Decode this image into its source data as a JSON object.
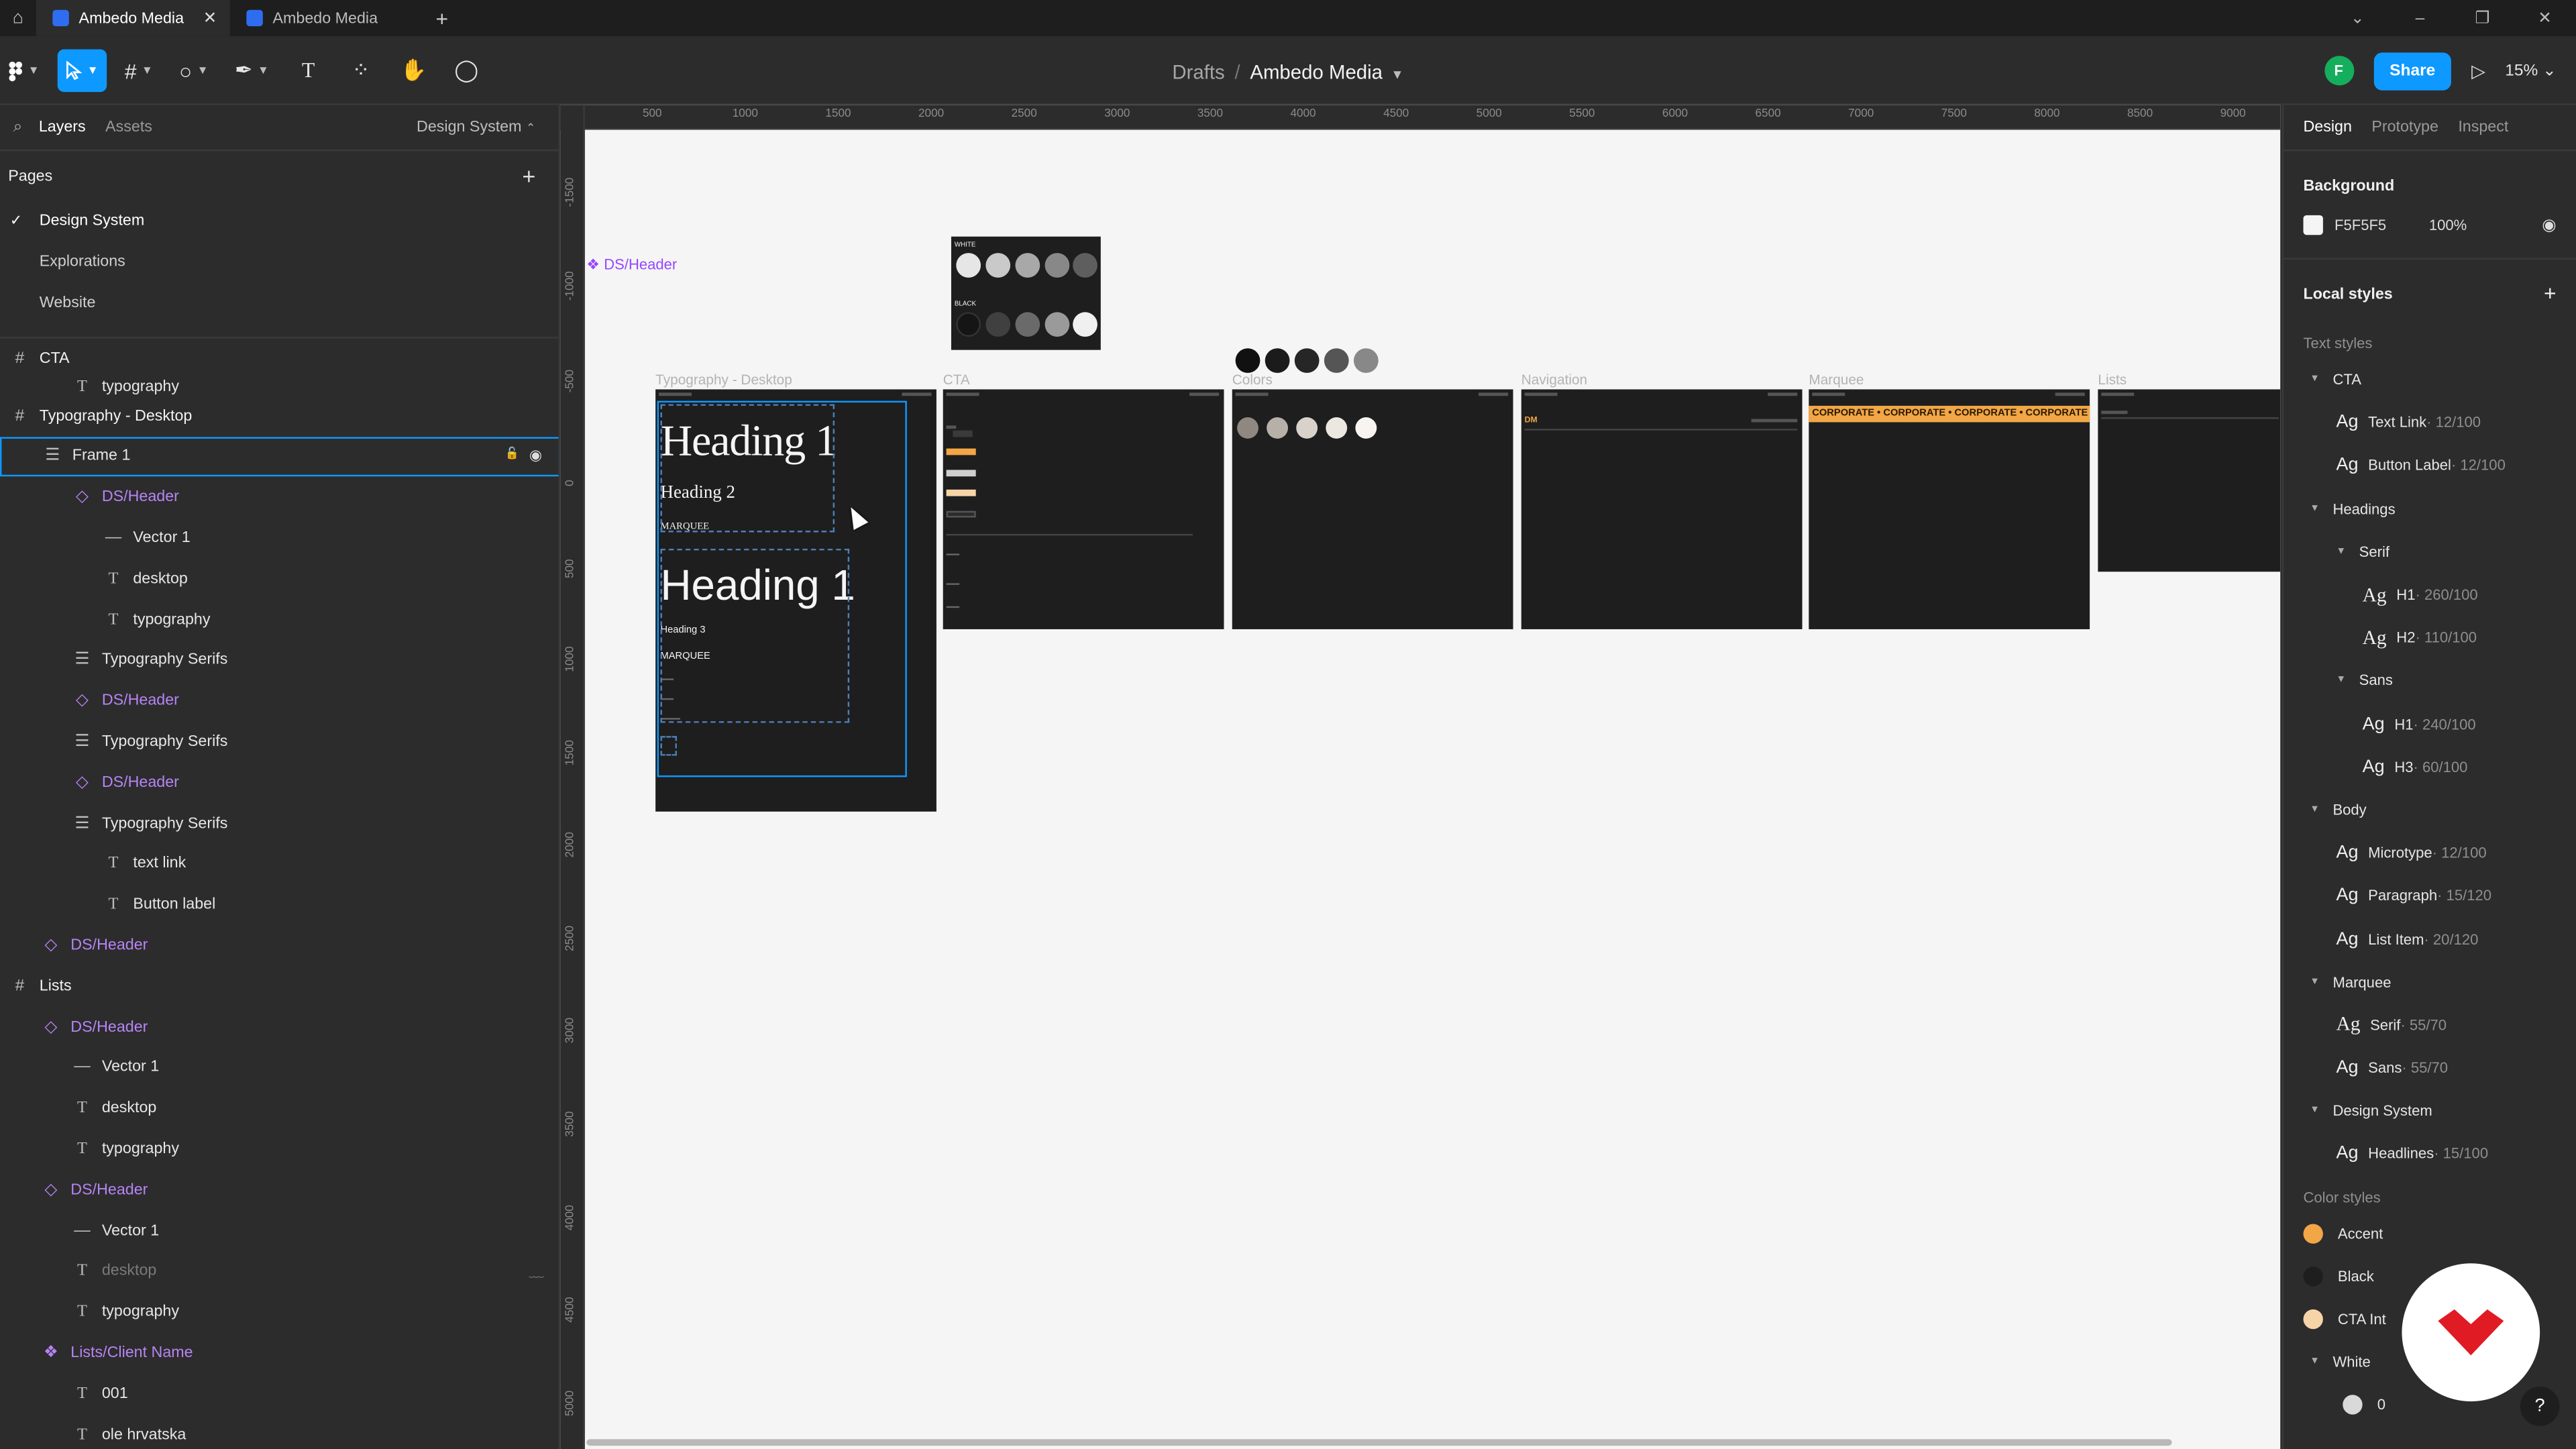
{
  "tabs": [
    {
      "label": "Ambedo Media",
      "active": true
    },
    {
      "label": "Ambedo Media",
      "active": false
    }
  ],
  "window": {
    "minimize": "–",
    "restore": "❐",
    "close": "✕",
    "more": "⌄"
  },
  "toolbar": {
    "breadcrumb_root": "Drafts",
    "breadcrumb_sep": "/",
    "file_name": "Ambedo Media",
    "avatar_initial": "F",
    "share_label": "Share",
    "zoom": "15%"
  },
  "left_panel": {
    "tab_layers": "Layers",
    "tab_assets": "Assets",
    "page_selector": "Design System",
    "pages_heading": "Pages",
    "pages": [
      {
        "label": "Design System",
        "current": true
      },
      {
        "label": "Explorations",
        "current": false
      },
      {
        "label": "Website",
        "current": false
      }
    ],
    "layers": [
      {
        "label": "CTA",
        "type": "frame",
        "indent": 0
      },
      {
        "label": "typography",
        "type": "text",
        "indent": 2
      },
      {
        "label": "Typography - Desktop",
        "type": "frame",
        "indent": 0
      },
      {
        "label": "Frame 1",
        "type": "autolayout",
        "indent": 1,
        "selected": true
      },
      {
        "label": "DS/Header",
        "type": "component",
        "indent": 2
      },
      {
        "label": "Vector 1",
        "type": "vector",
        "indent": 3
      },
      {
        "label": "desktop",
        "type": "text",
        "indent": 3
      },
      {
        "label": "typography",
        "type": "text",
        "indent": 3
      },
      {
        "label": "Typography Serifs",
        "type": "autolayout",
        "indent": 2
      },
      {
        "label": "DS/Header",
        "type": "component",
        "indent": 2
      },
      {
        "label": "Typography Serifs",
        "type": "autolayout",
        "indent": 2
      },
      {
        "label": "DS/Header",
        "type": "component",
        "indent": 2
      },
      {
        "label": "Typography Serifs",
        "type": "autolayout",
        "indent": 2
      },
      {
        "label": "text link",
        "type": "text",
        "indent": 3
      },
      {
        "label": "Button label",
        "type": "text",
        "indent": 3
      },
      {
        "label": "DS/Header",
        "type": "component",
        "indent": 1
      },
      {
        "label": "Lists",
        "type": "frame",
        "indent": 0
      },
      {
        "label": "DS/Header",
        "type": "component",
        "indent": 1
      },
      {
        "label": "Vector 1",
        "type": "vector",
        "indent": 2
      },
      {
        "label": "desktop",
        "type": "text",
        "indent": 2
      },
      {
        "label": "typography",
        "type": "text",
        "indent": 2
      },
      {
        "label": "DS/Header",
        "type": "component",
        "indent": 1
      },
      {
        "label": "Vector 1",
        "type": "vector",
        "indent": 2
      },
      {
        "label": "desktop",
        "type": "text",
        "indent": 2,
        "hidden": true
      },
      {
        "label": "typography",
        "type": "text",
        "indent": 2
      },
      {
        "label": "Lists/Client Name",
        "type": "instance",
        "indent": 1
      },
      {
        "label": "001",
        "type": "text",
        "indent": 2
      },
      {
        "label": "ole hrvatska",
        "type": "text",
        "indent": 2
      }
    ]
  },
  "canvas": {
    "ruler_top": [
      "500",
      "1000",
      "1500",
      "2000",
      "2500",
      "3000",
      "3500",
      "4000",
      "4500",
      "5000",
      "5500",
      "6000",
      "6500",
      "7000",
      "7500",
      "8000",
      "8500",
      "9000"
    ],
    "ruler_left": [
      "-1500",
      "-1000",
      "-500",
      "0",
      "500",
      "1000",
      "1500",
      "2000",
      "2500",
      "3000",
      "3500",
      "4000",
      "4500",
      "5000"
    ],
    "component_label": "DS/Header",
    "frame_labels": {
      "typography": "Typography - Desktop",
      "cta": "CTA",
      "colors": "Colors",
      "navigation": "Navigation",
      "marquee": "Marquee",
      "lists": "Lists"
    },
    "palette": {
      "white_label": "WHITE",
      "black_label": "BLACK"
    },
    "typo_frame": {
      "h1_a": "Heading 1",
      "h2": "Heading 2",
      "marquee_a": "MARQUEE",
      "h1_b": "Heading 1",
      "h3": "Heading 3",
      "marquee_b": "MARQUEE"
    },
    "marquee_text": "CORPORATE  •  CORPORATE  •  CORPORATE  •  CORPORATE  •",
    "nav_badge": "DM",
    "bg": "#F5F5F5"
  },
  "right_panel": {
    "tab_design": "Design",
    "tab_prototype": "Prototype",
    "tab_inspect": "Inspect",
    "background_heading": "Background",
    "bg_hex": "F5F5F5",
    "bg_opacity": "100%",
    "local_styles_heading": "Local styles",
    "text_styles_label": "Text styles",
    "color_styles_label": "Color styles",
    "text_styles": [
      {
        "kind": "group",
        "label": "CTA",
        "level": 0
      },
      {
        "kind": "style",
        "label": "Text Link",
        "meta": " · 12/100",
        "level": 1,
        "serif": false
      },
      {
        "kind": "style",
        "label": "Button Label",
        "meta": " · 12/100",
        "level": 1,
        "serif": false
      },
      {
        "kind": "group",
        "label": "Headings",
        "level": 0
      },
      {
        "kind": "group",
        "label": "Serif",
        "level": 1
      },
      {
        "kind": "style",
        "label": "H1",
        "meta": " · 260/100",
        "level": 2,
        "serif": true
      },
      {
        "kind": "style",
        "label": "H2",
        "meta": " · 110/100",
        "level": 2,
        "serif": true
      },
      {
        "kind": "group",
        "label": "Sans",
        "level": 1
      },
      {
        "kind": "style",
        "label": "H1",
        "meta": " · 240/100",
        "level": 2,
        "serif": false
      },
      {
        "kind": "style",
        "label": "H3",
        "meta": " · 60/100",
        "level": 2,
        "serif": false
      },
      {
        "kind": "group",
        "label": "Body",
        "level": 0
      },
      {
        "kind": "style",
        "label": "Microtype",
        "meta": " · 12/100",
        "level": 1,
        "serif": false
      },
      {
        "kind": "style",
        "label": "Paragraph",
        "meta": " · 15/120",
        "level": 1,
        "serif": false
      },
      {
        "kind": "style",
        "label": "List Item",
        "meta": " · 20/120",
        "level": 1,
        "serif": false
      },
      {
        "kind": "group",
        "label": "Marquee",
        "level": 0
      },
      {
        "kind": "style",
        "label": "Serif",
        "meta": " · 55/70",
        "level": 1,
        "serif": true
      },
      {
        "kind": "style",
        "label": "Sans",
        "meta": " · 55/70",
        "level": 1,
        "serif": false
      },
      {
        "kind": "group",
        "label": "Design System",
        "level": 0
      },
      {
        "kind": "style",
        "label": "Headlines",
        "meta": " · 15/100",
        "level": 1,
        "serif": false
      }
    ],
    "color_styles": [
      {
        "label": "Accent",
        "color": "#F2A646",
        "group": false
      },
      {
        "label": "Black",
        "color": "#1E1E1E",
        "group": false
      },
      {
        "label": "CTA Int",
        "color": "#F6D4A8",
        "group": false
      },
      {
        "label": "White",
        "color": "",
        "group": true
      },
      {
        "label": "0",
        "color": "#D9D9D9",
        "group": false,
        "sub": true
      }
    ],
    "help": "?"
  },
  "colors": {
    "accent": "#0D99FF",
    "component": "#9747FF",
    "marquee": "#F2A646"
  }
}
